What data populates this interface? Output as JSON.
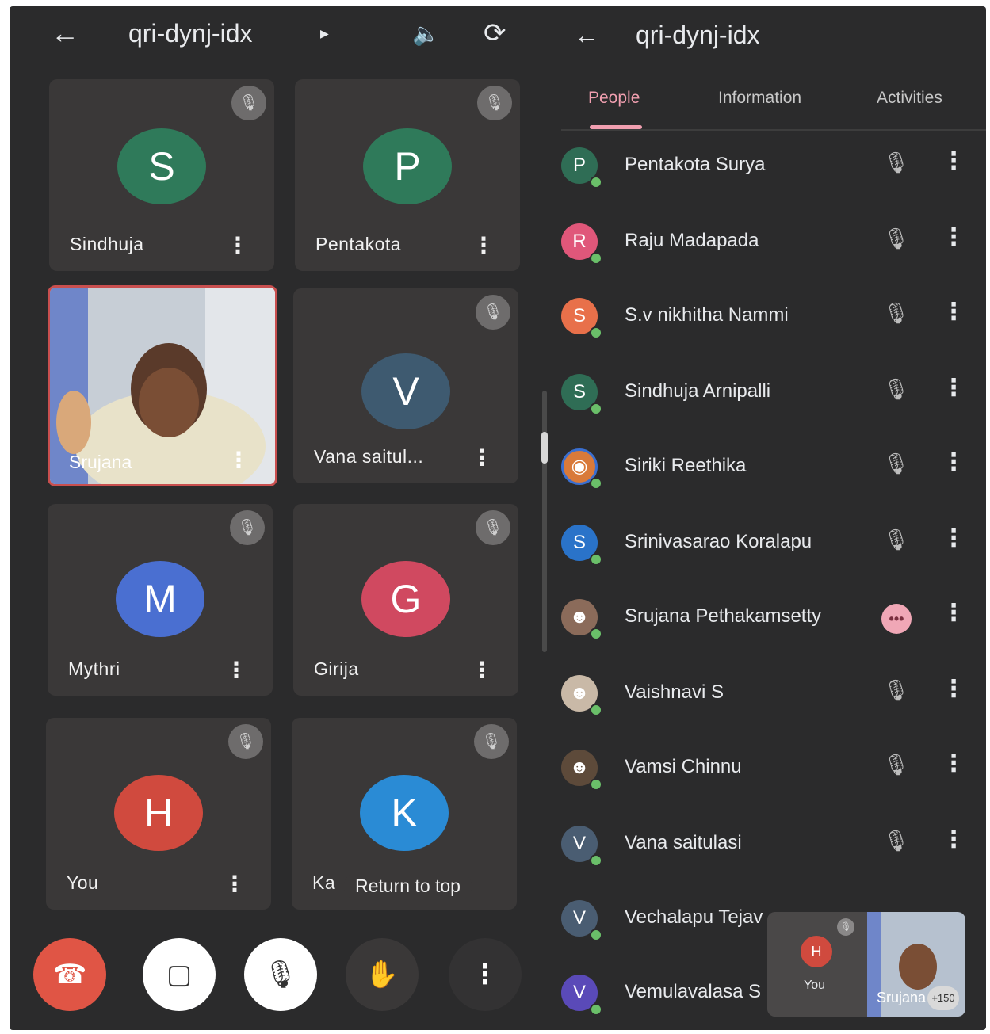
{
  "meeting": {
    "code": "qri-dynj-idx"
  },
  "call_tiles": [
    {
      "initial": "S",
      "name": "Sindhuja",
      "color": "#2f7a5a"
    },
    {
      "initial": "P",
      "name": "Pentakota",
      "color": "#2f7a5a"
    },
    {
      "initial": "",
      "name": "Srujana",
      "color": ""
    },
    {
      "initial": "V",
      "name": "Vana saitul...",
      "color": "#3e5a70"
    },
    {
      "initial": "M",
      "name": "Mythri",
      "color": "#4a6fd1"
    },
    {
      "initial": "G",
      "name": "Girija",
      "color": "#d04960"
    },
    {
      "initial": "H",
      "name": "You",
      "color": "#d04a3e"
    },
    {
      "initial": "K",
      "name": "Ka",
      "color": "#2a8bd5"
    }
  ],
  "return_to_top": "Return to top",
  "panel": {
    "title": "qri-dynj-idx",
    "tabs": [
      "People",
      "Information",
      "Activities"
    ],
    "active_tab": "People"
  },
  "people": [
    {
      "initial": "P",
      "name": "Pentakota Surya",
      "color": "#2f6d55",
      "status": "muted"
    },
    {
      "initial": "R",
      "name": "Raju Madapada",
      "color": "#e0577a",
      "status": "muted"
    },
    {
      "initial": "S",
      "name": "S.v nikhitha Nammi",
      "color": "#e8704a",
      "status": "muted"
    },
    {
      "initial": "S",
      "name": "Sindhuja Arnipalli",
      "color": "#2f6d55",
      "status": "muted"
    },
    {
      "initial": "",
      "name": "Siriki Reethika",
      "color": "#d97a3a",
      "status": "muted"
    },
    {
      "initial": "S",
      "name": "Srinivasarao Koralapu",
      "color": "#2a73c9",
      "status": "muted"
    },
    {
      "initial": "",
      "name": "Srujana Pethakamsetty",
      "color": "#8b6b5a",
      "status": "speaking"
    },
    {
      "initial": "",
      "name": "Vaishnavi S",
      "color": "#c9b9a7",
      "status": "muted"
    },
    {
      "initial": "",
      "name": "Vamsi Chinnu",
      "color": "#5d4a3a",
      "status": "muted"
    },
    {
      "initial": "V",
      "name": "Vana saitulasi",
      "color": "#4a5d72",
      "status": "muted"
    },
    {
      "initial": "V",
      "name": "Vechalapu Tejav",
      "color": "#4a5d72",
      "status": "muted"
    },
    {
      "initial": "V",
      "name": "Vemulavalasa S",
      "color": "#5a4ab8",
      "status": "muted"
    }
  ],
  "self_view": {
    "initial": "H",
    "you_label": "You",
    "other_name": "Srujana",
    "count": "+150"
  }
}
